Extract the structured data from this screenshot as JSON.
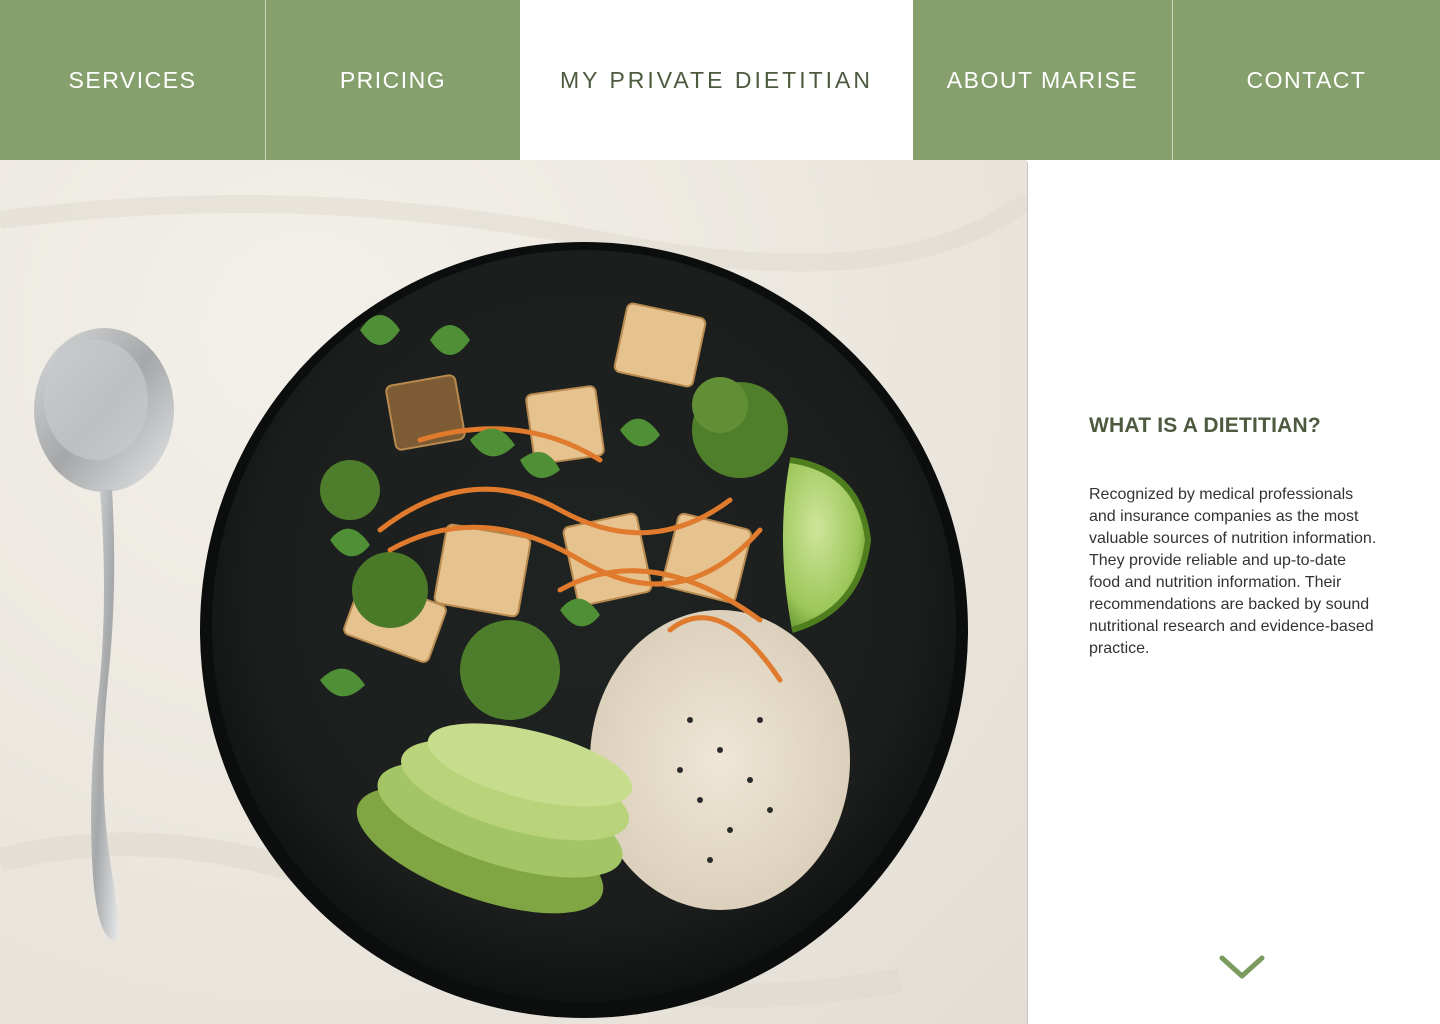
{
  "nav": {
    "items": [
      {
        "label": "SERVICES"
      },
      {
        "label": "PRICING"
      },
      {
        "label": "MY PRIVATE DIETITIAN"
      },
      {
        "label": "ABOUT MARISE"
      },
      {
        "label": "CONTACT"
      }
    ]
  },
  "hero": {
    "image": "food-bowl-photo"
  },
  "panel": {
    "title": "WHAT IS A DIETITIAN?",
    "paragraph_1": "Recognized by medical professionals and insurance companies as the most valuable sources of nutrition information.",
    "paragraph_2": "They provide reliable and up-to-date food and nutrition information. Their recommendations are backed by sound nutritional research and evidence-based practice.",
    "scroll_icon": "chevron-down-icon"
  },
  "colors": {
    "nav_green": "#86a06d",
    "brand_text": "#4d5a3f",
    "accent": "#7a9a5e"
  }
}
